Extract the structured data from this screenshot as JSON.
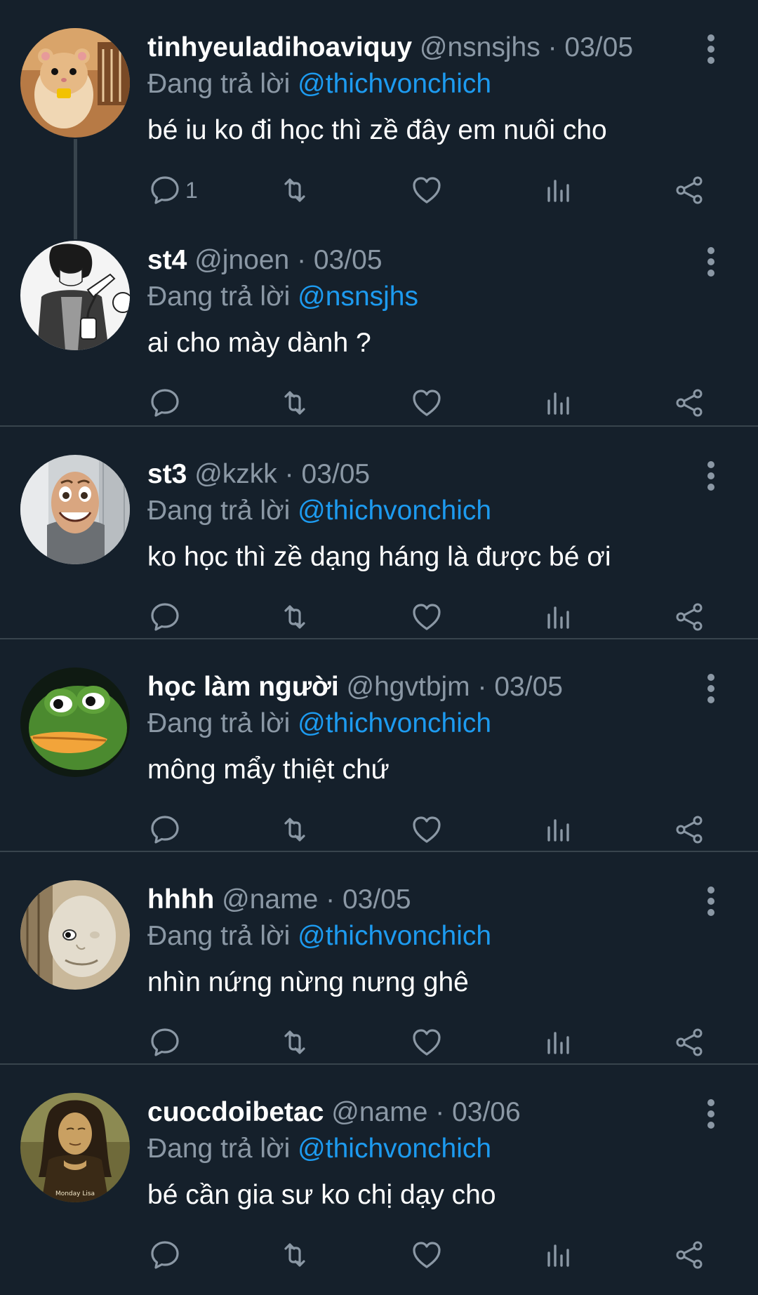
{
  "reply_prefix": "Đang trả lời",
  "separator": "·",
  "colors": {
    "background": "#15202b",
    "divider": "#38444d",
    "secondary_text": "#8b98a5",
    "mention": "#1d9bf0"
  },
  "tweets": [
    {
      "display_name": "tinhyeuladihoaviquy",
      "handle": "@nsnsjhs",
      "date": "03/05",
      "reply_to": "@thichvonchich",
      "text": "bé iu ko đi học thì zề đây em nuôi cho",
      "reply_count": "1",
      "avatar": "hamster-avatar"
    },
    {
      "display_name": "st4",
      "handle": "@jnoen",
      "date": "03/05",
      "reply_to": "@nsnsjhs",
      "text": "ai cho mày dành ?",
      "reply_count": "",
      "avatar": "manga-avatar"
    },
    {
      "display_name": "st3",
      "handle": "@kzkk",
      "date": "03/05",
      "reply_to": "@thichvonchich",
      "text": "ko học thì zề dạng háng là được bé ơi",
      "reply_count": "",
      "avatar": "woody-face-avatar"
    },
    {
      "display_name": "học làm người",
      "handle": "@hgvtbjm",
      "date": "03/05",
      "reply_to": "@thichvonchich",
      "text": "mông mẩy thiệt chứ",
      "reply_count": "",
      "avatar": "pepe-frog-avatar"
    },
    {
      "display_name": "hhhh",
      "handle": "@name",
      "date": "03/05",
      "reply_to": "@thichvonchich",
      "text": "nhìn nứng nừng nưng ghê",
      "reply_count": "",
      "avatar": "robot-face-avatar"
    },
    {
      "display_name": "cuocdoibetac",
      "handle": "@name",
      "date": "03/06",
      "reply_to": "@thichvonchich",
      "text": "bé cần gia sư ko chị dạy cho",
      "reply_count": "",
      "avatar": "monalisa-avatar",
      "avatar_caption": "Monday Lisa"
    }
  ]
}
